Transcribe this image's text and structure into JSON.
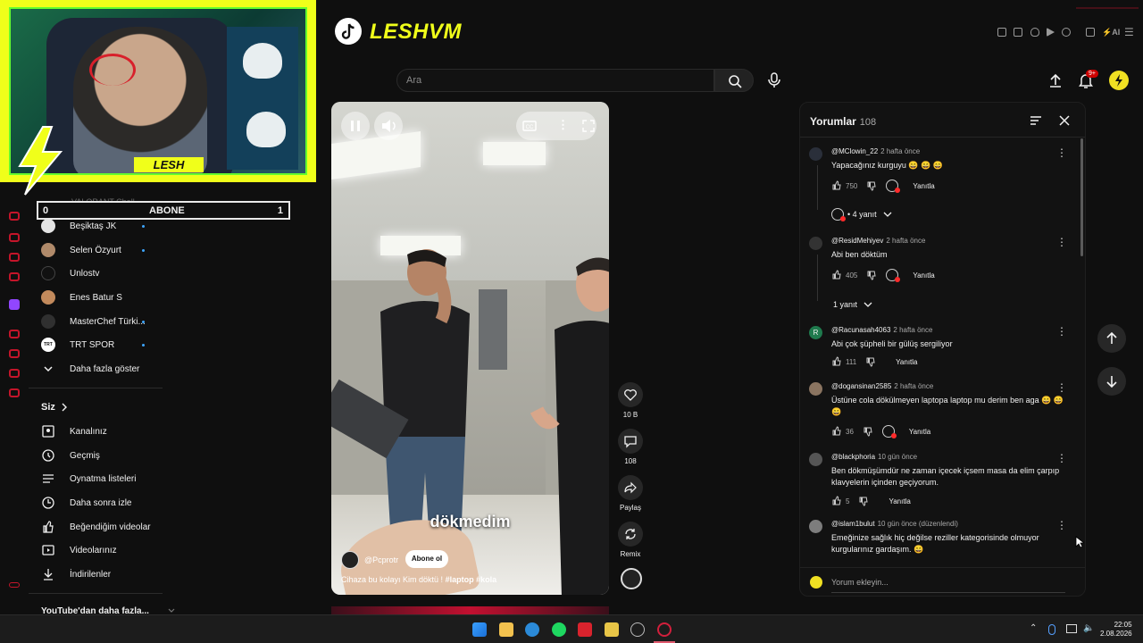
{
  "webcam": {
    "name": "LESH"
  },
  "subscribe_bar": {
    "left_count": "0",
    "label": "ABONE",
    "right_count": "1",
    "behind_text": "VALORANT Chall..."
  },
  "sidebar": {
    "subscriptions": [
      {
        "label": "Beşiktaş JK",
        "color": "#e4e4e4",
        "dot": true
      },
      {
        "label": "Selen Özyurt",
        "color": "#b08a6a",
        "dot": true
      },
      {
        "label": "Unlostv",
        "color": "#111111",
        "dot": false
      },
      {
        "label": "Enes Batur S",
        "color": "#c28a5c",
        "dot": false
      },
      {
        "label": "MasterChef Türki...",
        "color": "#303030",
        "dot": true
      },
      {
        "label": "TRT SPOR",
        "color": "#ffffff",
        "dot": true
      }
    ],
    "more_label": "Daha fazla göster",
    "you_heading": "Siz",
    "you_items": [
      "Kanalınız",
      "Geçmiş",
      "Oynatma listeleri",
      "Daha sonra izle",
      "Beğendiğim videolar",
      "Videolarınız",
      "İndirilenler"
    ],
    "more_from_youtube": "YouTube'dan daha fazla..."
  },
  "header": {
    "logo_text": "LESHVM",
    "search_placeholder": "Ara",
    "notification_count": "9+"
  },
  "video": {
    "subtitle": "dökmedim",
    "channel": "@Pcprotr",
    "subscribe_label": "Abone ol",
    "caption_text": "Cihaza bu kolayı Kim döktü !",
    "caption_tags": "#laptop #kola"
  },
  "actions": [
    {
      "name": "like",
      "label": "10 B"
    },
    {
      "name": "comments",
      "label": "108"
    },
    {
      "name": "share",
      "label": "Paylaş"
    },
    {
      "name": "remix",
      "label": "Remix"
    }
  ],
  "comments": {
    "title": "Yorumlar",
    "count": "108",
    "add_placeholder": "Yorum ekleyin...",
    "items": [
      {
        "user": "@MClowin_22",
        "time": "2 hafta önce",
        "text": "Yapacağınız kurguyu 😄 😄 😄",
        "likes": "750",
        "reply_label": "Yanıtla",
        "thread": "• 4 yanıt",
        "color": "#2a2f3a"
      },
      {
        "user": "@ResidMehiyev",
        "time": "2 hafta önce",
        "text": "Abi ben döktüm",
        "likes": "405",
        "reply_label": "Yanıtla",
        "thread": "1 yanıt",
        "color": "#333333"
      },
      {
        "user": "@Racunasah4063",
        "time": "2 hafta önce",
        "text": "Abi çok şüpheli bir gülüş sergiliyor",
        "likes": "111",
        "reply_label": "Yanıtla",
        "initial": "R",
        "color": "#1f7a4d"
      },
      {
        "user": "@dogansinan2585",
        "time": "2 hafta önce",
        "text": "Üstüne cola dökülmeyen laptopa laptop mu derim ben aga 😄 😄 😄",
        "likes": "36",
        "reply_label": "Yanıtla",
        "color": "#8a7460"
      },
      {
        "user": "@blackphoria",
        "time": "10 gün önce",
        "text": "Ben dökmüşümdür ne zaman içecek içsem masa da elim çarpıp klavyelerin içinden geçiyorum.",
        "likes": "5",
        "reply_label": "Yanıtla",
        "color": "#555555"
      },
      {
        "user": "@islam1bulut",
        "time": "10 gün önce (düzenlendi)",
        "text": "Emeğinize sağlık hiç değilse reziller kategorisinde olmuyor kurgularınız gardaşım. 😄",
        "color": "#7d7d7d"
      }
    ]
  },
  "taskbar": {
    "time": "22:05",
    "date": "2.08.2026"
  }
}
